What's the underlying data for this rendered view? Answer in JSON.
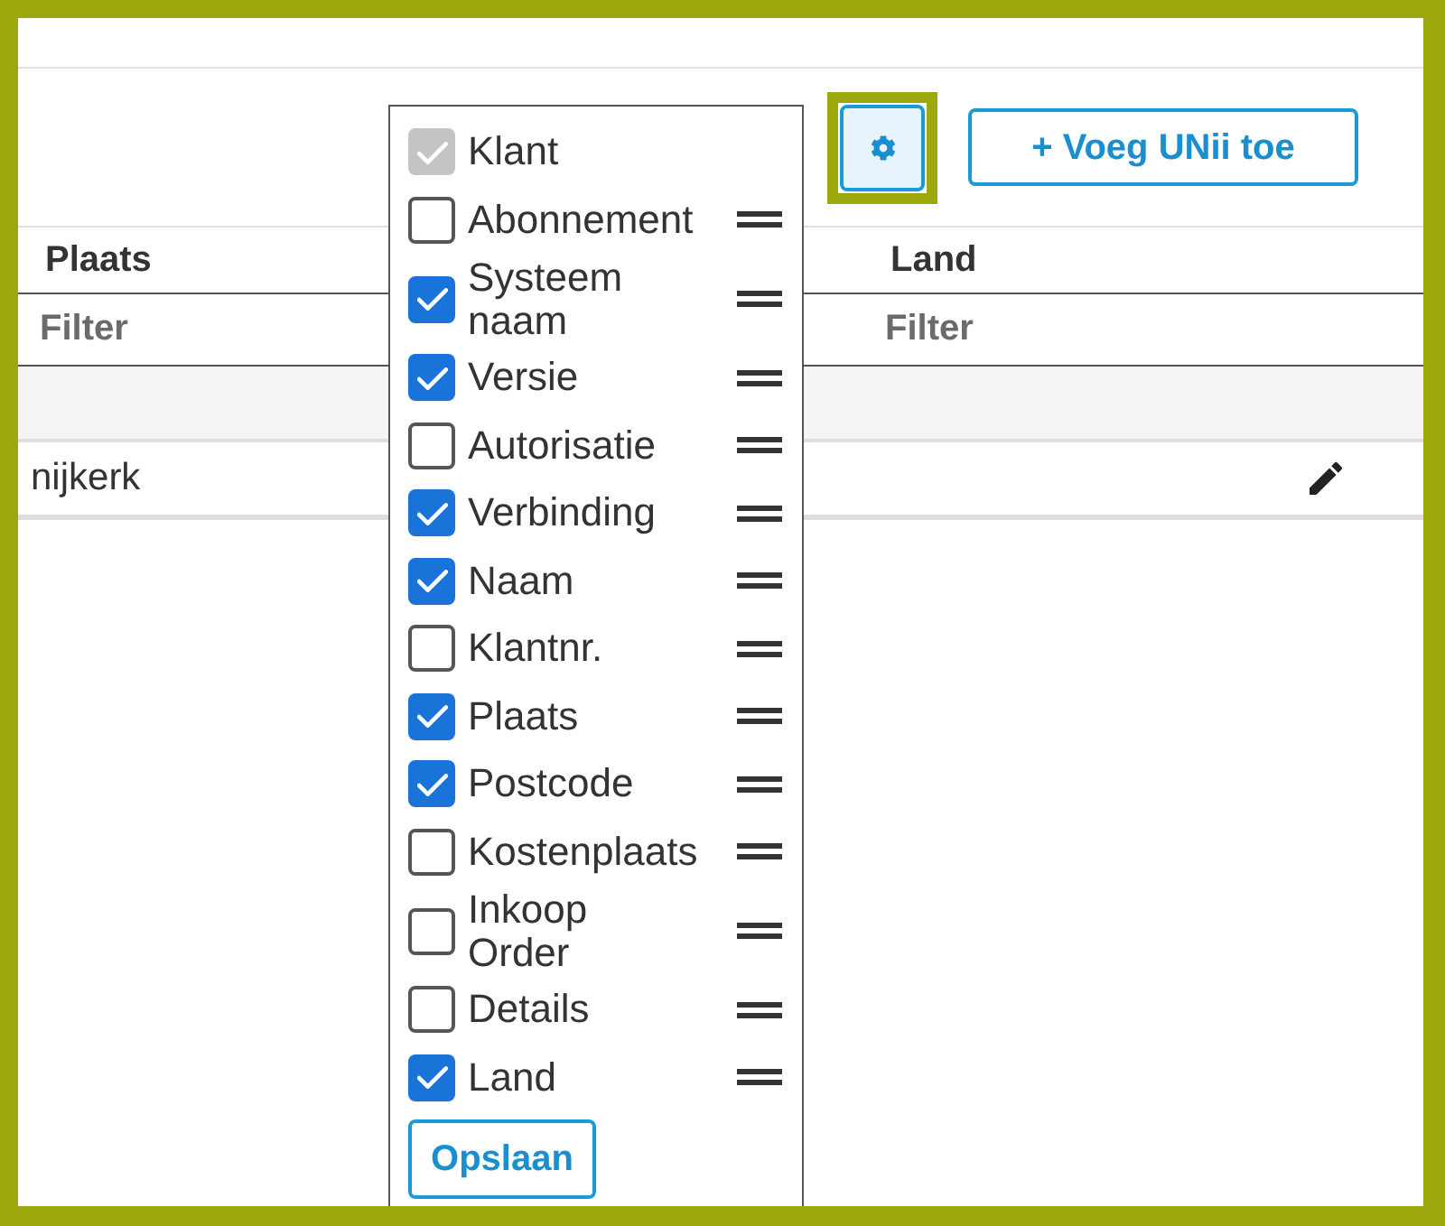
{
  "toolbar": {
    "settings_button": {
      "highlighted": true
    },
    "add_button": {
      "label": "+ Voeg UNii toe"
    }
  },
  "table": {
    "columns": [
      {
        "label": "Plaats",
        "filter_placeholder": "Filter"
      },
      {
        "label": "Land",
        "filter_placeholder": "Filter"
      }
    ],
    "rows": [
      {
        "cells": [
          "nijkerk"
        ]
      }
    ]
  },
  "column_chooser": {
    "items": [
      {
        "label": "Klant",
        "checked": true,
        "disabled": true,
        "draggable": false
      },
      {
        "label": "Abonnement",
        "checked": false,
        "disabled": false,
        "draggable": true
      },
      {
        "label": "Systeem naam",
        "checked": true,
        "disabled": false,
        "draggable": true
      },
      {
        "label": "Versie",
        "checked": true,
        "disabled": false,
        "draggable": true
      },
      {
        "label": "Autorisatie",
        "checked": false,
        "disabled": false,
        "draggable": true
      },
      {
        "label": "Verbinding",
        "checked": true,
        "disabled": false,
        "draggable": true
      },
      {
        "label": "Naam",
        "checked": true,
        "disabled": false,
        "draggable": true
      },
      {
        "label": "Klantnr.",
        "checked": false,
        "disabled": false,
        "draggable": true
      },
      {
        "label": "Plaats",
        "checked": true,
        "disabled": false,
        "draggable": true
      },
      {
        "label": "Postcode",
        "checked": true,
        "disabled": false,
        "draggable": true
      },
      {
        "label": "Kostenplaats",
        "checked": false,
        "disabled": false,
        "draggable": true
      },
      {
        "label": "Inkoop Order",
        "checked": false,
        "disabled": false,
        "draggable": true
      },
      {
        "label": "Details",
        "checked": false,
        "disabled": false,
        "draggable": true
      },
      {
        "label": "Land",
        "checked": true,
        "disabled": false,
        "draggable": true
      }
    ],
    "save_button": {
      "label": "Opslaan"
    }
  }
}
